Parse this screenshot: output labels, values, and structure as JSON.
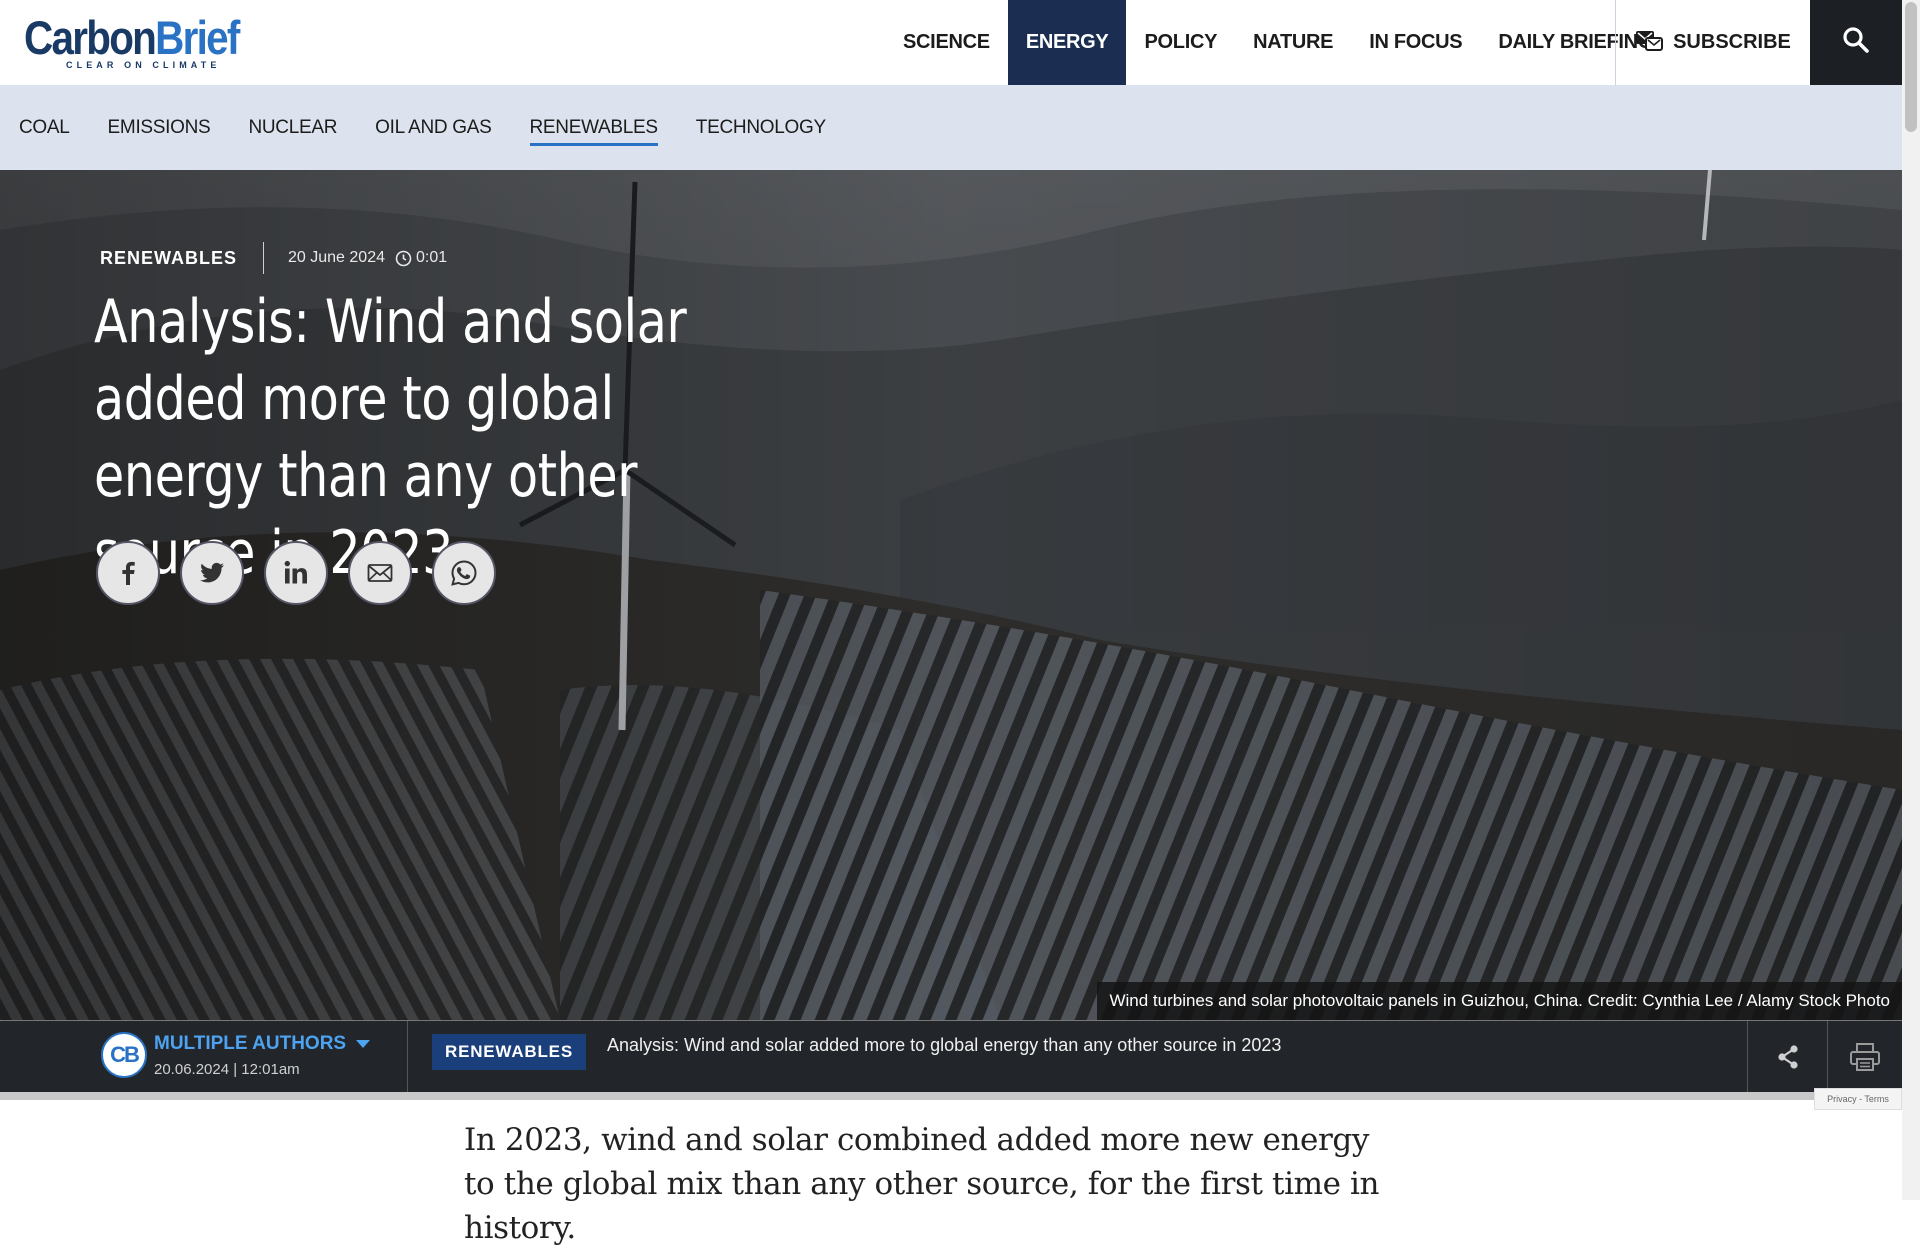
{
  "header": {
    "logo": {
      "part1": "Carbon",
      "part2": "Brief",
      "tagline": "CLEAR ON CLIMATE"
    },
    "nav": [
      {
        "label": "SCIENCE",
        "active": false
      },
      {
        "label": "ENERGY",
        "active": true
      },
      {
        "label": "POLICY",
        "active": false
      },
      {
        "label": "NATURE",
        "active": false
      },
      {
        "label": "IN FOCUS",
        "active": false
      },
      {
        "label": "DAILY BRIEFING",
        "active": false
      }
    ],
    "subscribe_label": "SUBSCRIBE"
  },
  "subnav": [
    {
      "label": "COAL",
      "active": false
    },
    {
      "label": "EMISSIONS",
      "active": false
    },
    {
      "label": "NUCLEAR",
      "active": false
    },
    {
      "label": "OIL AND GAS",
      "active": false
    },
    {
      "label": "RENEWABLES",
      "active": true
    },
    {
      "label": "TECHNOLOGY",
      "active": false
    }
  ],
  "hero": {
    "category": "RENEWABLES",
    "date": "20 June 2024",
    "time": "0:01",
    "title": "Analysis: Wind and solar added more to global energy than any other source in 2023",
    "share": [
      "facebook-icon",
      "twitter-icon",
      "linkedin-icon",
      "email-icon",
      "whatsapp-icon"
    ],
    "caption": "Wind turbines and solar photovoltaic panels in Guizhou, China. Credit: Cynthia Lee / Alamy Stock Photo"
  },
  "author_bar": {
    "avatar": "CB",
    "authors_label": "MULTIPLE AUTHORS",
    "date": "20.06.2024 | 12:01am",
    "badge": "RENEWABLES",
    "title": "Analysis: Wind and solar added more to global energy than any other source in 2023",
    "reading_progress": 0
  },
  "article": {
    "lede": "In 2023, wind and solar combined added more new energy to the global mix than any other source, for the first time in history."
  },
  "recaptcha_text": "Privacy - Terms",
  "colors": {
    "brand_dark": "#1b2e52",
    "brand_blue": "#2a72c4",
    "subnav_bg": "#dde3ee"
  }
}
